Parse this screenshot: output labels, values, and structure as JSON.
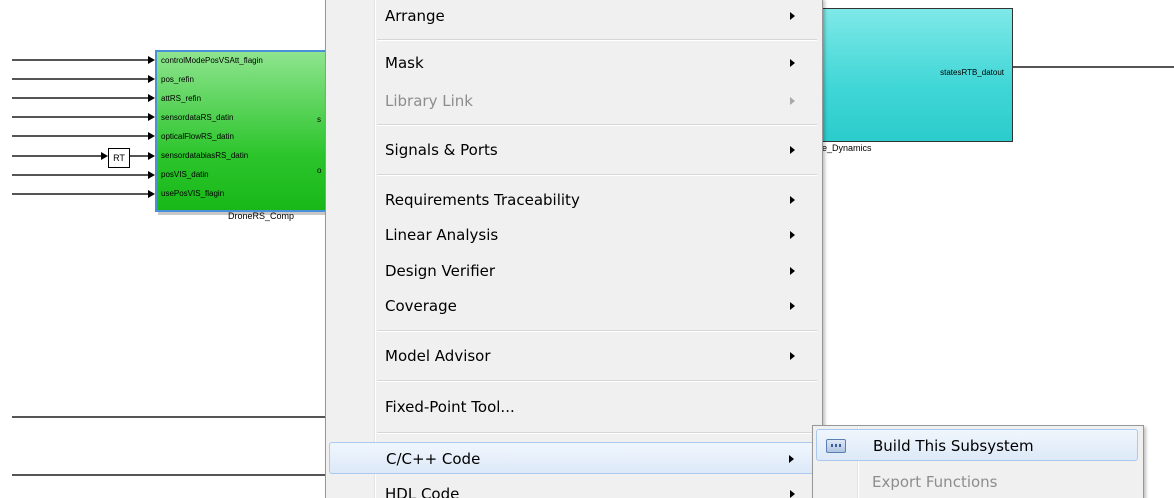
{
  "diagram": {
    "drone_block": {
      "name": "DroneRS_Comp",
      "input_ports": [
        "controlModePosVSAtt_flagin",
        "pos_refin",
        "attRS_refin",
        "sensordataRS_datin",
        "opticalFlowRS_datin",
        "sensordatabiasRS_datin",
        "posVIS_datin",
        "usePosVIS_flagin"
      ],
      "output_port_fragments": [
        "s",
        "o"
      ]
    },
    "rt_block": {
      "label": "RT"
    },
    "dynamics_block": {
      "caption": "e_Dynamics",
      "output_port": "statesRTB_datout"
    },
    "colors": {
      "drone_block_fill": "#2cc52c",
      "dynamics_block_fill": "#3fd6d6",
      "selection_border": "#4a90d9"
    }
  },
  "context_menu": {
    "items": [
      {
        "label": "Arrange",
        "submenu": true,
        "enabled": true
      },
      {
        "label": "Mask",
        "submenu": true,
        "enabled": true
      },
      {
        "label": "Library Link",
        "submenu": true,
        "enabled": false
      },
      {
        "label": "Signals & Ports",
        "submenu": true,
        "enabled": true
      },
      {
        "label": "Requirements Traceability",
        "submenu": true,
        "enabled": true
      },
      {
        "label": "Linear Analysis",
        "submenu": true,
        "enabled": true
      },
      {
        "label": "Design Verifier",
        "submenu": true,
        "enabled": true
      },
      {
        "label": "Coverage",
        "submenu": true,
        "enabled": true
      },
      {
        "label": "Model Advisor",
        "submenu": true,
        "enabled": true
      },
      {
        "label": "Fixed-Point Tool...",
        "submenu": false,
        "enabled": true
      },
      {
        "label": "C/C++ Code",
        "submenu": true,
        "enabled": true,
        "highlighted": true
      },
      {
        "label": "HDL Code",
        "submenu": true,
        "enabled": true
      }
    ]
  },
  "submenu": {
    "parent": "C/C++ Code",
    "items": [
      {
        "label": "Build This Subsystem",
        "icon": "build-icon",
        "enabled": true,
        "highlighted": true
      },
      {
        "label": "Export Functions",
        "enabled": false
      }
    ]
  },
  "menu_colors": {
    "background": "#f0f0f0",
    "highlight": "#dde9f8",
    "highlight_border": "#a9c9ee",
    "disabled_text": "#8d8d8d"
  }
}
